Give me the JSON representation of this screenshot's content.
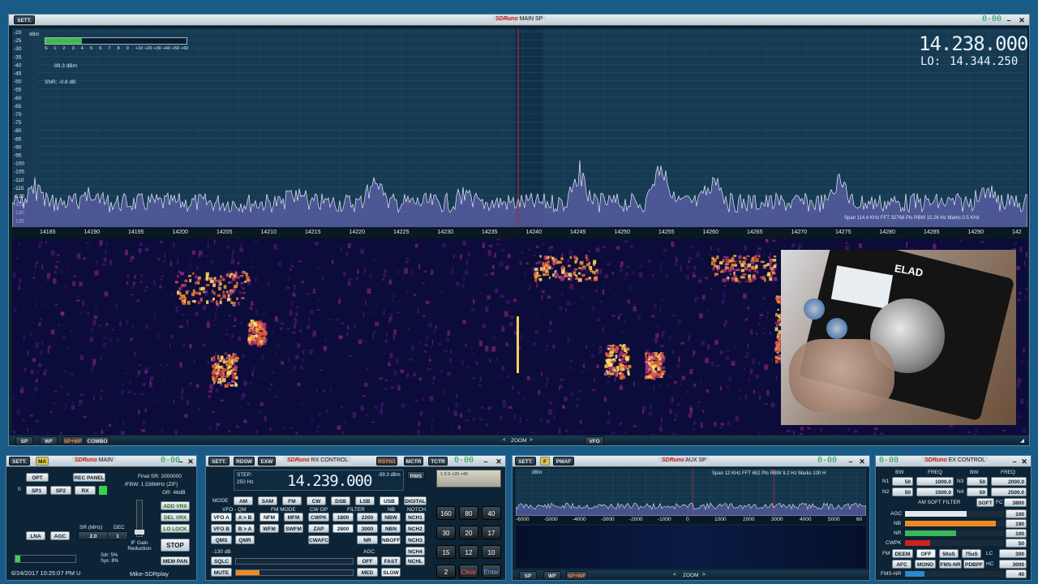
{
  "main_sp": {
    "sett_label": "SETT.",
    "title_logo": "SDRuno",
    "title_text": "MAIN SP",
    "freq": "14.238.000",
    "lo_label": "LO:",
    "lo_freq": "14.344.250",
    "green_lcd": "0-00",
    "dbm_unit": "dBm",
    "smeter_scale": [
      "S",
      "1",
      "2",
      "3",
      "4",
      "5",
      "6",
      "7",
      "8",
      "9",
      "+10",
      "+20",
      "+30",
      "+40",
      "+50",
      "+60"
    ],
    "level": "-99.3 dBm",
    "snr": "SNR: -0.8 dB",
    "yticks": [
      "-20",
      "-25",
      "-30",
      "-35",
      "-40",
      "-45",
      "-50",
      "-55",
      "-60",
      "-65",
      "-70",
      "-75",
      "-80",
      "-85",
      "-90",
      "-95",
      "-100",
      "-105",
      "-110",
      "-115",
      "-120",
      "-125",
      "-130",
      "-135",
      "-140"
    ],
    "xticks": [
      "14185",
      "14190",
      "14195",
      "14200",
      "14205",
      "14210",
      "14215",
      "14220",
      "14225",
      "14230",
      "14235",
      "14240",
      "14245",
      "14250",
      "14255",
      "14260",
      "14265",
      "14270",
      "14275",
      "14280",
      "14285",
      "14290",
      "142"
    ],
    "span_info": "Span 114.4 KHz   FFT 32768 Pts   RBW 15.26 Hz   Marks 0.5 KHz",
    "bottom_buttons": [
      "SP",
      "WF",
      "SP+WF",
      "COMBO"
    ],
    "zoom": "ZOOM",
    "vfo": "VFO",
    "elad_label": "ELAD"
  },
  "main_panel": {
    "sett": "SETT.",
    "ma": "MA",
    "logo": "SDRuno",
    "title": "MAIN",
    "green_lcd": "0-00",
    "opt": "OPT",
    "rec_panel": "REC PANEL",
    "final_sr": "Final SR: 2000000",
    "ifbw": "IFBW: 1.536MHz (ZIF)",
    "gr": "GR: 46dB",
    "zero": "0",
    "sp1": "SP1",
    "sp2": "SP2",
    "rx": "RX",
    "add_vrx": "ADD VRX",
    "del_vrx": "DEL VRX",
    "lo_lock": "LO LOCK",
    "sr_label": "SR (MHz)",
    "dec_label": "DEC",
    "lna": "LNA",
    "agc": "AGC",
    "sr_value": "2.0",
    "dec_value": "1",
    "if_gain": "IF Gain Reduction",
    "stop": "STOP",
    "mem_pan": "MEM PAN",
    "sdr_pct": "Sdr: 5%",
    "sys_pct": "Sys: 8%",
    "timestamp": "6/24/2017 10:25:07 PM U",
    "user": "Mike-SDRplay"
  },
  "rx_control": {
    "sett": "SETT.",
    "rdsw": "RDSW",
    "exw": "EXW",
    "logo": "SDRuno",
    "title": "RX CONTROL",
    "rsyn": "RSYN1",
    "mctr": "MCTR",
    "tctr": "TCTR",
    "green_lcd": "0-00",
    "step_label": "STEP:",
    "step_value": "250 Hz",
    "freq": "14.239.000",
    "level": "-99.3 dBm",
    "rms": "RMS",
    "mode_label": "MODE",
    "modes": [
      "AM",
      "SAM",
      "FM",
      "CW",
      "DSB",
      "LSB",
      "USB",
      "DIGITAL"
    ],
    "vfo_qm": "VFO - QM",
    "fm_mode": "FM MODE",
    "cw_op": "CW OP",
    "filter": "FILTER",
    "nb": "NB",
    "notch": "NOTCH",
    "vfo_a": "VFO A",
    "a_to_b": "A > B",
    "nfm": "NFM",
    "mfm": "MFM",
    "cwpk": "CWPK",
    "f1800": "1800",
    "f2200": "2200",
    "nbw": "NBW",
    "nch1": "NCH1",
    "vfo_b": "VFO B",
    "b_to_a": "B > A",
    "wfm": "WFM",
    "swfm": "SWFM",
    "zap": "ZAP",
    "f2800": "2800",
    "f3000": "3000",
    "nbn": "NBN",
    "nch2": "NCH2",
    "qms": "QMS",
    "qmr": "QMR",
    "cwafc": "CWAFC",
    "nr": "NR",
    "nboff": "NBOFF",
    "nch3": "NCH3",
    "nch4": "NCH4",
    "db_label": "-130 dB",
    "agc_label": "AGC",
    "sqlc": "SQLC",
    "agc_off": "OFF",
    "fast": "FAST",
    "nchl": "NCHL",
    "mute": "MUTE",
    "med": "MED",
    "slow": "SLOW",
    "keypad": [
      "160",
      "80",
      "40",
      "30",
      "20",
      "17",
      "15",
      "12",
      "10",
      "2"
    ],
    "clear": "Clear",
    "enter": "Enter",
    "meter_scale": "1  5  9  +20 +40"
  },
  "aux_sp": {
    "sett": "SETT.",
    "f": "F",
    "pmaf": "PMAF",
    "logo": "SDRuno",
    "title": "AUX SP",
    "green_lcd": "0-00",
    "dbm": "dBm",
    "span_info": "Span 12 KHz   FFT 652 Pts   RBW 9.2 Hz   Marks 100 H",
    "xticks": [
      "-6000",
      "-5000",
      "-4000",
      "-3000",
      "-2000",
      "-1000",
      "0",
      "1000",
      "2000",
      "3000",
      "4000",
      "5000",
      "60"
    ],
    "bottom": [
      "SP",
      "WF",
      "SP+WF"
    ],
    "zoom": "ZOOM"
  },
  "ex_control": {
    "green_lcd": "0-00",
    "logo": "SDRuno",
    "title": "EX CONTROL",
    "headers": [
      "BW",
      "FREQ",
      "BW",
      "FREQ"
    ],
    "n1": "N1",
    "n1_bw": "50",
    "n1_freq": "1000.0",
    "n3": "N3",
    "n3_bw": "50",
    "n3_freq": "2000.0",
    "n2": "N2",
    "n2_bw": "50",
    "n2_freq": "1500.0",
    "n4": "N4",
    "n4_bw": "50",
    "n4_freq": "2500.0",
    "am_soft_filter": "AM SOFT FILTER",
    "soft": "SOFT",
    "fc": "FC",
    "fc_value": "3800",
    "agc": "AGC",
    "agc_val": "100",
    "nb": "NB",
    "nb_val": "190",
    "nr": "NR",
    "nr_val": "100",
    "cwpk": "CWPK",
    "cwpk_val": "50",
    "fm": "FM",
    "deem": "DEEM",
    "off": "OFF",
    "us50": "50uS",
    "us75": "75uS",
    "lc": "LC",
    "lc_val": "300",
    "afc": "AFC",
    "mono": "MONO",
    "fmsnr": "FMS-NR",
    "pdbpf": "PDBPF",
    "hc": "HC",
    "hc_val": "3000",
    "fmsnr2": "FMS-NR",
    "fmsnr_val": "40",
    "agc_level": 0.62,
    "nb_level": 0.92,
    "nr_level": 0.52,
    "cwpk_level": 0.25,
    "fmsnr_level": 0.2
  }
}
